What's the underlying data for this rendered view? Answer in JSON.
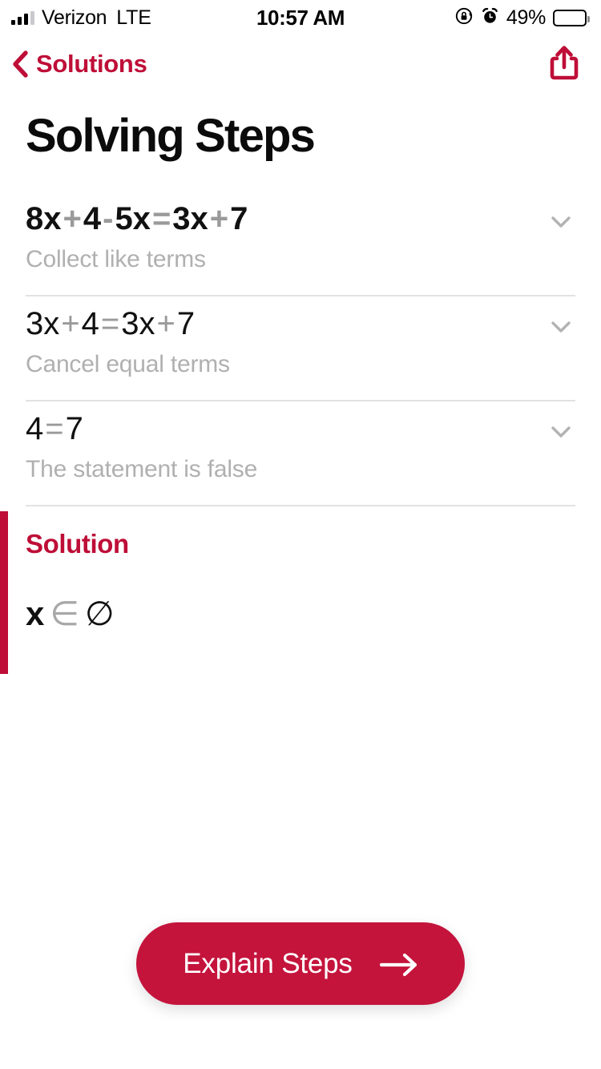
{
  "status_bar": {
    "carrier": "Verizon",
    "radio": "LTE",
    "time": "10:57 AM",
    "battery_percent": "49%",
    "battery_level": 49,
    "icons": [
      "signal-bars-icon",
      "rotation-lock-icon",
      "alarm-clock-icon",
      "battery-icon"
    ]
  },
  "nav": {
    "back_label": "Solutions",
    "back_icon": "chevron-left-icon",
    "share_icon": "share-icon",
    "accent_color": "#BE0E37"
  },
  "page_title": "Solving Steps",
  "steps": [
    {
      "equation_parts": [
        {
          "text": "8x",
          "kind": "term"
        },
        {
          "text": "+",
          "kind": "op"
        },
        {
          "text": "4",
          "kind": "term"
        },
        {
          "text": "-",
          "kind": "op"
        },
        {
          "text": "5x",
          "kind": "term"
        },
        {
          "text": "=",
          "kind": "op"
        },
        {
          "text": "3x",
          "kind": "term"
        },
        {
          "text": "+",
          "kind": "op"
        },
        {
          "text": "7",
          "kind": "term"
        }
      ],
      "equation_plain": "8x + 4 - 5x = 3x + 7",
      "description": "Collect like terms",
      "weight": "bold",
      "expander_icon": "chevron-down-icon",
      "expanded": false
    },
    {
      "equation_parts": [
        {
          "text": "3x",
          "kind": "term"
        },
        {
          "text": "+",
          "kind": "op"
        },
        {
          "text": "4",
          "kind": "term"
        },
        {
          "text": "=",
          "kind": "op"
        },
        {
          "text": "3x",
          "kind": "term"
        },
        {
          "text": "+",
          "kind": "op"
        },
        {
          "text": "7",
          "kind": "term"
        }
      ],
      "equation_plain": "3x + 4 = 3x + 7",
      "description": "Cancel equal terms",
      "weight": "normal",
      "expander_icon": "chevron-down-icon",
      "expanded": false
    },
    {
      "equation_parts": [
        {
          "text": "4",
          "kind": "term"
        },
        {
          "text": "=",
          "kind": "op"
        },
        {
          "text": "7",
          "kind": "term"
        }
      ],
      "equation_plain": "4 = 7",
      "description": "The statement is false",
      "weight": "normal",
      "expander_icon": "chevron-down-icon",
      "expanded": false
    }
  ],
  "solution": {
    "title": "Solution",
    "variable": "x",
    "relation": "∈",
    "set": "∅",
    "plain": "x ∈ ∅",
    "accent_color": "#BE0E37"
  },
  "cta": {
    "label": "Explain Steps",
    "icon": "arrow-right-icon",
    "color": "#C4143C"
  }
}
